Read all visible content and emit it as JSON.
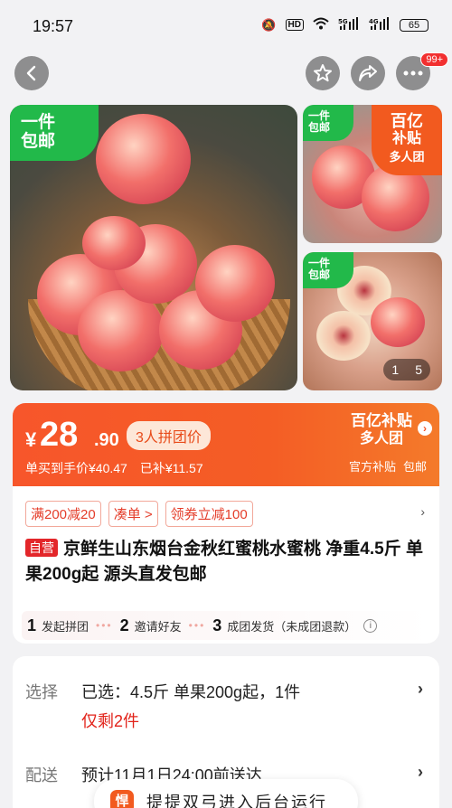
{
  "status_bar": {
    "time": "19:57",
    "network": "5G",
    "network2": "4G",
    "hd": "HD",
    "battery": "65"
  },
  "nav": {
    "back_icon": "back-arrow-icon",
    "fav_icon": "star-icon",
    "share_icon": "share-icon",
    "more_icon": "more-icon",
    "more_badge": "99+"
  },
  "gallery": {
    "main_tag": [
      "一件",
      "包邮"
    ],
    "side_tag_a": [
      "一件",
      "包邮"
    ],
    "side_tag_b": [
      "一件",
      "包邮"
    ],
    "promo_badge": {
      "l1": "百亿",
      "l2": "补贴",
      "l3": "多人团"
    },
    "counter": {
      "current": "1",
      "total": "5"
    }
  },
  "price": {
    "currency": "¥",
    "integer": "28",
    "decimal": ".90",
    "group_label": "3人拼团价",
    "single_price": "单买到手价¥40.47",
    "subsidy": "已补¥11.57",
    "brand_l1": "百亿补贴",
    "brand_l2": "多人团",
    "official_subsidy": "官方补贴",
    "free_shipping": "包邮"
  },
  "product": {
    "coupons": [
      "满200减20",
      "凑单 >",
      "领券立减100"
    ],
    "self_tag": "自营",
    "title": "京鲜生山东烟台金秋红蜜桃水蜜桃 净重4.5斤 单果200g起 源头直发包邮",
    "steps": [
      {
        "num": "1",
        "text": "发起拼团"
      },
      {
        "num": "2",
        "text": "邀请好友"
      },
      {
        "num": "3",
        "text": "成团发货（未成团退款）"
      }
    ]
  },
  "selection": {
    "select_label": "选择",
    "select_value": "已选：4.5斤 单果200g起，1件",
    "stock_warning": "仅剩2件",
    "delivery_label": "配送",
    "delivery_value": "预计11月1日24:00前送达"
  },
  "toast": {
    "text": "提提双弓进入后台运行"
  }
}
